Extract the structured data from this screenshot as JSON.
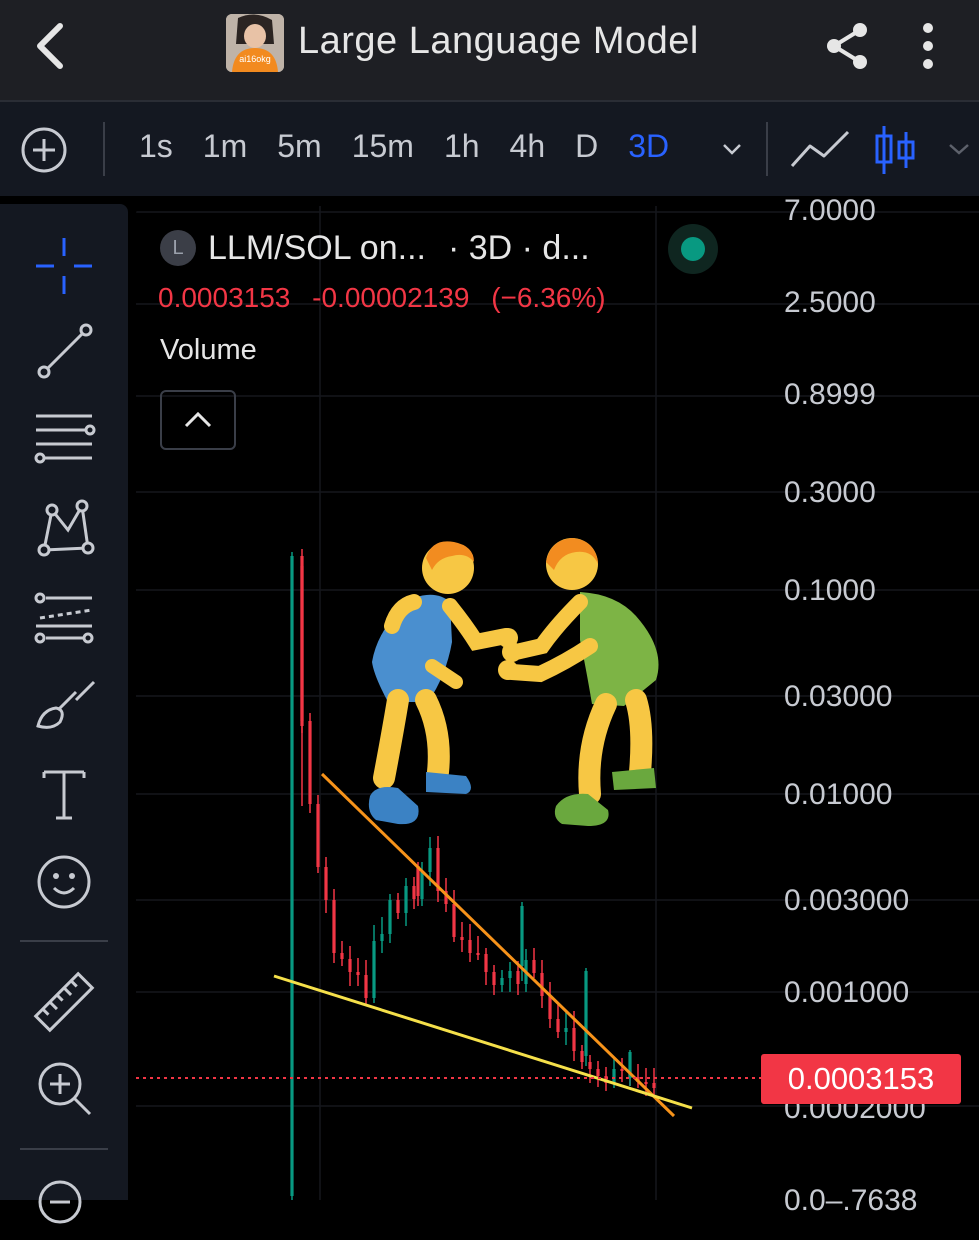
{
  "header": {
    "title": "Large Language Model",
    "avatar_text": "ai16okg",
    "back_icon": "back-arrow-icon",
    "share_icon": "share-icon",
    "more_icon": "more-vertical-icon"
  },
  "toolbar": {
    "intervals": [
      "1s",
      "1m",
      "5m",
      "15m",
      "1h",
      "4h",
      "D",
      "3D"
    ],
    "active_interval": "3D",
    "chart_type_icons": [
      "line-chart-icon",
      "candlestick-icon"
    ]
  },
  "left_tools": [
    "crosshair-icon",
    "trendline-icon",
    "horizontal-lines-icon",
    "pattern-icon",
    "forecast-icon",
    "brush-icon",
    "text-icon",
    "emoji-icon",
    "ruler-icon",
    "zoom-in-icon",
    "zoom-out-icon"
  ],
  "legend": {
    "badge": "L",
    "symbol": "LLM/SOL on...",
    "interval_text": "· 3D · d...",
    "open_price": "0.0003153",
    "change": "-0.00002139",
    "change_pct": "(−6.36%)",
    "volume_label": "Volume"
  },
  "y_axis": {
    "labels": [
      "7.0000",
      "2.5000",
      "0.8999",
      "0.3000",
      "0.1000",
      "0.03000",
      "0.01000",
      "0.003000",
      "0.001000",
      "0.0002000",
      "0.0–.7638"
    ],
    "current_price": "0.0003153"
  },
  "colors": {
    "up": "#089981",
    "down": "#f23645",
    "accent": "#2962ff",
    "trend_upper": "#f7931a",
    "trend_lower": "#f5e04a"
  },
  "overlay_emoji": "wrestlers"
}
